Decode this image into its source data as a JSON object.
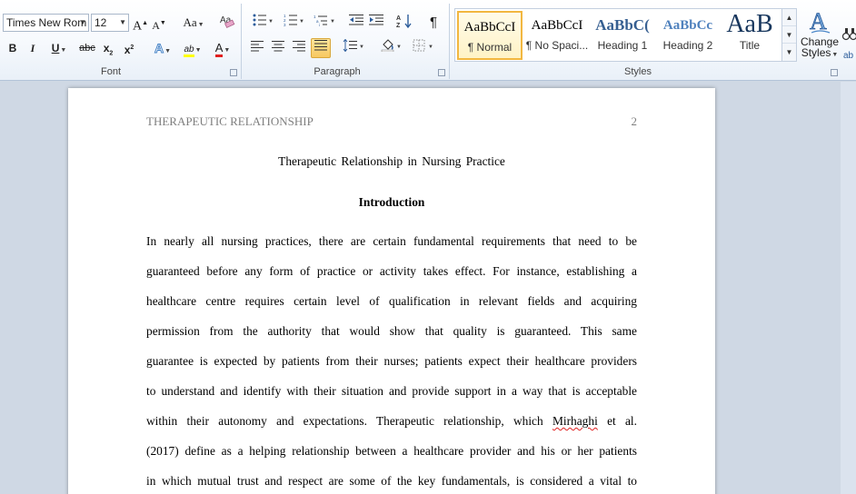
{
  "font": {
    "font_name": "Times New Rom",
    "font_size": "12",
    "grow_label": "A",
    "shrink_label": "A",
    "change_case_label": "Aa",
    "bold": "B",
    "italic": "I",
    "underline": "U",
    "strike": "abc",
    "subscript": "x",
    "subscript_mark": "2",
    "superscript": "x",
    "superscript_mark": "2",
    "text_effects": "A",
    "highlight": "ab",
    "font_color": "A",
    "group_label": "Font"
  },
  "paragraph": {
    "group_label": "Paragraph",
    "pilcrow": "¶"
  },
  "styles": {
    "group_label": "Styles",
    "items": [
      {
        "sample": "AaBbCcI",
        "name": "¶ Normal"
      },
      {
        "sample": "AaBbCcI",
        "name": "¶ No Spaci..."
      },
      {
        "sample": "AaBbC(",
        "name": "Heading 1"
      },
      {
        "sample": "AaBbCc",
        "name": "Heading 2"
      },
      {
        "sample": "AaB",
        "name": "Title"
      }
    ],
    "change_styles_label1": "Change",
    "change_styles_label2": "Styles"
  },
  "colors": {
    "heading_blue": "#365f91",
    "heading2_blue": "#4f81bd",
    "title_blue": "#17365d",
    "font_color_red": "#e02020",
    "highlight_yellow": "#ffff00"
  },
  "document": {
    "running_head": "THERAPEUTIC RELATIONSHIP",
    "page_number": "2",
    "title": "Therapeutic Relationship in Nursing Practice",
    "section_heading": "Introduction",
    "lines": [
      "In nearly all nursing practices, there are certain fundamental requirements that need to be",
      "guaranteed before any form of practice or activity takes effect. For instance, establishing a",
      "healthcare centre requires certain level of qualification in relevant fields and acquiring",
      "permission from the authority that would show that quality is guaranteed. This same",
      "guarantee is expected by patients from their nurses; patients expect their healthcare providers",
      "to understand and identify with their situation and provide support in a way that is acceptable",
      "within their autonomy and expectations. Therapeutic relationship, which",
      "(2017) define as a helping relationship between a healthcare provider and his or her patients",
      "in which mutual trust and respect are some of the key fundamentals, is considered a vital to"
    ],
    "line7_name": "Mirhaghi",
    "line7_tail": "et al."
  }
}
